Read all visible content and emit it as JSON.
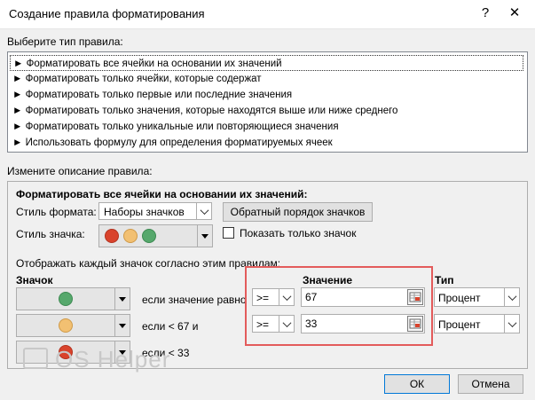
{
  "window": {
    "title": "Создание правила форматирования",
    "help_label": "?",
    "close_label": "✕"
  },
  "rule_type": {
    "label": "Выберите тип правила:",
    "items": [
      "► Форматировать все ячейки на основании их значений",
      "► Форматировать только ячейки, которые содержат",
      "► Форматировать только первые или последние значения",
      "► Форматировать только значения, которые находятся выше или ниже среднего",
      "► Форматировать только уникальные или повторяющиеся значения",
      "► Использовать формулу для определения форматируемых ячеек"
    ],
    "selected_index": 0
  },
  "description": {
    "label": "Измените описание правила:",
    "heading": "Форматировать все ячейки на основании их значений:",
    "format_style_label": "Стиль формата:",
    "format_style_value": "Наборы значков",
    "reverse_order_button": "Обратный порядок значков",
    "icon_style_label": "Стиль значка:",
    "icon_colors": [
      "#d9432c",
      "#f2c072",
      "#56a86c"
    ],
    "show_icon_only_label": "Показать только значок",
    "show_icon_only_checked": false,
    "rules_caption": "Отображать каждый значок согласно этим правилам:",
    "col_icon": "Значок",
    "col_value": "Значение",
    "col_type": "Тип",
    "rows": [
      {
        "icon": "green-circle-icon",
        "condition": "если значение равно",
        "operator": ">=",
        "value": "67",
        "type": "Процент"
      },
      {
        "icon": "yellow-circle-icon",
        "condition": "если < 67 и",
        "operator": ">=",
        "value": "33",
        "type": "Процент"
      },
      {
        "icon": "red-circle-icon",
        "condition": "если < 33"
      }
    ]
  },
  "buttons": {
    "ok": "ОК",
    "cancel": "Отмена"
  },
  "watermark": "OS Helper",
  "highlight_color": "#e35b5b"
}
